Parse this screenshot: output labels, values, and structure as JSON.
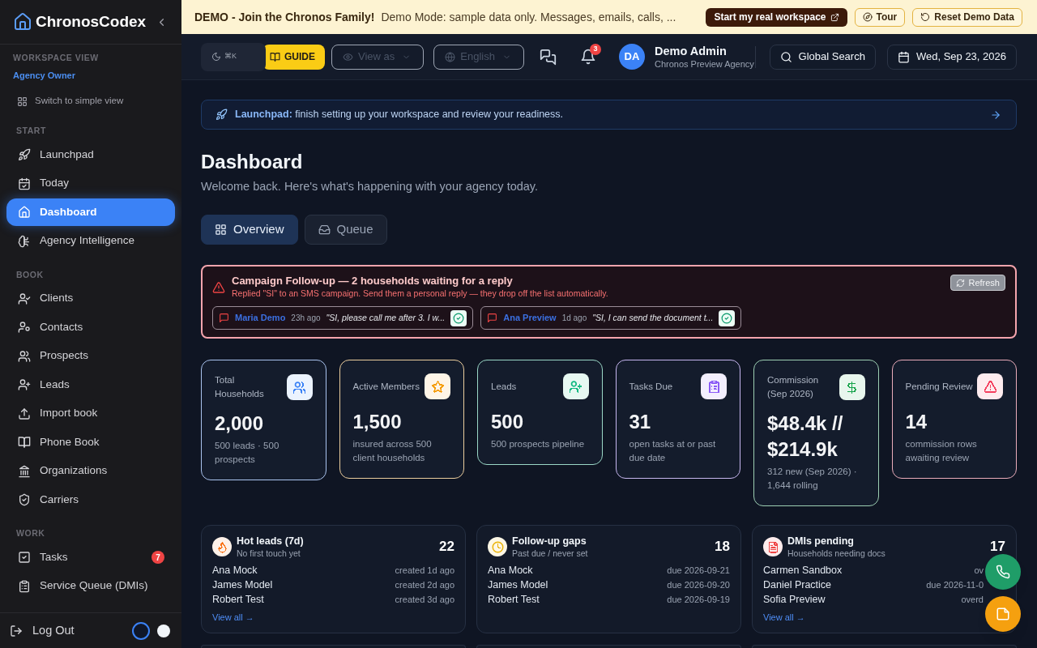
{
  "banner": {
    "title": "DEMO - Join the Chronos Family!",
    "message": "Demo Mode: sample data only. Messages, emails, calls, ...",
    "buttons": [
      {
        "label": "Start my real workspace",
        "kind": "primary"
      },
      {
        "label": "Tour",
        "kind": "outline"
      },
      {
        "label": "Reset Demo Data",
        "kind": "outline"
      }
    ]
  },
  "sidebar": {
    "brand": "ChronosCodex",
    "workspace_label": "WORKSPACE VIEW",
    "workspace_role": "Agency Owner",
    "switch_view": "Switch to simple view",
    "sections": [
      {
        "title": "START",
        "items": [
          {
            "label": "Launchpad",
            "selected": false
          },
          {
            "label": "Today",
            "selected": false
          },
          {
            "label": "Dashboard",
            "selected": true
          },
          {
            "label": "Agency Intelligence",
            "selected": false
          }
        ]
      },
      {
        "title": "BOOK",
        "items": [
          {
            "label": "Clients",
            "selected": false
          },
          {
            "label": "Contacts",
            "selected": false
          },
          {
            "label": "Prospects",
            "selected": false
          },
          {
            "label": "Leads",
            "selected": false
          },
          {
            "label": "Import book",
            "selected": false
          },
          {
            "label": "Phone Book",
            "selected": false
          },
          {
            "label": "Organizations",
            "selected": false
          },
          {
            "label": "Carriers",
            "selected": false
          }
        ]
      },
      {
        "title": "WORK",
        "items": [
          {
            "label": "Tasks",
            "selected": false,
            "badge": "7"
          },
          {
            "label": "Service Queue (DMIs)",
            "selected": false
          }
        ]
      }
    ],
    "logout": "Log Out",
    "theme_options": [
      {
        "selected": true,
        "color": "#0f172a"
      },
      {
        "selected": false,
        "color": "#f1f5f9"
      }
    ]
  },
  "header": {
    "shortcut": "⌘K",
    "guide": "GUIDE",
    "view_as": {
      "label": "View as",
      "disabled": true
    },
    "language": {
      "label": "English",
      "disabled": true
    },
    "notifications": "3",
    "user": {
      "initials": "DA",
      "name": "Demo Admin",
      "agency": "Chronos Preview Agency"
    },
    "search": "Global Search",
    "date": "Wed, Sep 23, 2026"
  },
  "launchpad": {
    "text": "**Launchpad:** finish setting up your workspace and review your readiness."
  },
  "page": {
    "title": "Dashboard",
    "subtitle": "Welcome back. Here's what's happening with your agency today."
  },
  "tabs": [
    {
      "label": "Overview",
      "selected": true
    },
    {
      "label": "Queue",
      "selected": false
    }
  ],
  "alert": {
    "title": "Campaign Follow-up — 2 households waiting for a reply",
    "text": "Replied \"SI\" to an SMS campaign. Send them a personal reply — they drop off the list automatically.",
    "refresh": {
      "label": "Refresh",
      "disabled": true
    },
    "replies": [
      {
        "name": "Maria Demo",
        "time": "23h ago",
        "message": "\"SI, please call me after 3. I w..."
      },
      {
        "name": "Ana Preview",
        "time": "1d ago",
        "message": "\"SI, I can send the document t..."
      }
    ]
  },
  "stats": [
    {
      "label": "Total Households",
      "value": "2,000",
      "detail": "500 leads · 500 prospects",
      "color": "#3b82f6"
    },
    {
      "label": "Active Members",
      "value": "1,500",
      "detail": "insured across 500 client households",
      "color": "#f59e0b"
    },
    {
      "label": "Leads",
      "value": "500",
      "detail": "500 prospects pipeline",
      "color": "#10b981"
    },
    {
      "label": "Tasks Due",
      "value": "31",
      "detail": "open tasks at or past due date",
      "color": "#8b5cf6"
    },
    {
      "label": "Commission (Sep 2026)",
      "value": "$48.4k // $214.9k",
      "detail": "312 new (Sep 2026) · 1,644 rolling",
      "color": "#16a34a"
    },
    {
      "label": "Pending Review",
      "value": "14",
      "detail": "commission rows awaiting review",
      "color": "#f43f5e"
    }
  ],
  "panels": [
    {
      "title": "Hot leads (7d)",
      "subtitle": "No first touch yet",
      "count": "22",
      "color": "#f97316",
      "rows": [
        {
          "name": "Ana Mock",
          "detail": "created 1d ago"
        },
        {
          "name": "James Model",
          "detail": "created 2d ago"
        },
        {
          "name": "Robert Test",
          "detail": "created 3d ago"
        }
      ],
      "link": "View all →"
    },
    {
      "title": "Follow-up gaps",
      "subtitle": "Past due / never set",
      "count": "18",
      "color": "#eab308",
      "rows": [
        {
          "name": "Ana Mock",
          "detail": "due 2026-09-21"
        },
        {
          "name": "James Model",
          "detail": "due 2026-09-20"
        },
        {
          "name": "Robert Test",
          "detail": "due 2026-09-19"
        }
      ]
    },
    {
      "title": "DMIs pending",
      "subtitle": "Households needing docs",
      "count": "17",
      "color": "#ef4444",
      "rows": [
        {
          "name": "Carmen Sandbox",
          "detail": "ov"
        },
        {
          "name": "Daniel Practice",
          "detail": "due 2026-11-0"
        },
        {
          "name": "Sofia Preview",
          "detail": "overd"
        }
      ],
      "link": "View all →"
    }
  ]
}
